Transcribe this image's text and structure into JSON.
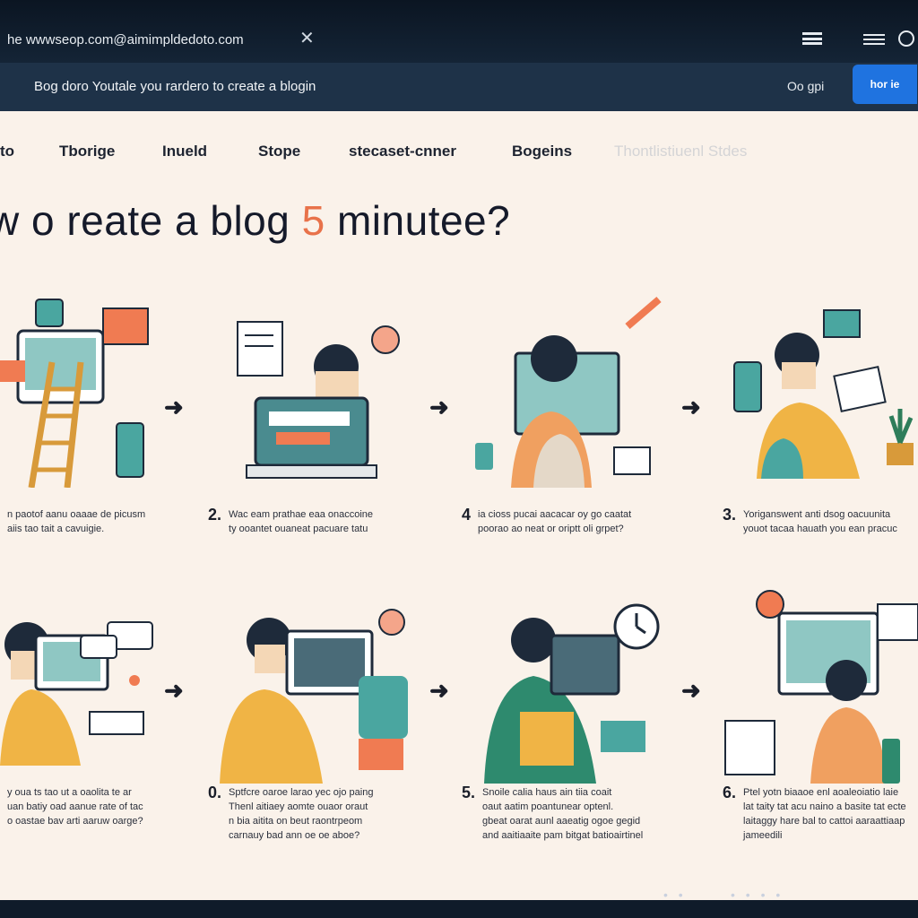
{
  "browser": {
    "url": "he wwwseop.com@aimimpldedoto.com",
    "close_glyph": "✕"
  },
  "banner": {
    "text": "Bog doro Youtale you rardero to create a blogin",
    "link": "Oo gpi",
    "button": "hor ie"
  },
  "nav": {
    "items": [
      "to",
      "Tborige",
      "Inueld",
      "Stope",
      "stecaset-cnner",
      "Bogeins",
      "Thontlistiuenl Stdes"
    ]
  },
  "headline": {
    "before": "w o reate  a blog ",
    "highlight": "5",
    "after": " minutee?"
  },
  "steps": [
    {
      "num": "",
      "lines": [
        "n paotof aanu oaaae de picusm",
        "aiis tao tait a cavuigie."
      ]
    },
    {
      "num": "2.",
      "lines": [
        "Wac eam prathae eaa onaccoine",
        "ty ooantet ouaneat pacuare tatu"
      ]
    },
    {
      "num": "4",
      "lines": [
        "ia cioss pucai aacacar oy go caatat",
        "poorao ao neat or oriptt oli grpet?"
      ]
    },
    {
      "num": "3.",
      "lines": [
        "Yoriganswent anti dsog oacuunita",
        "youot tacaa hauath you ean pracuc"
      ]
    },
    {
      "num": "",
      "lines": [
        "y oua ts tao ut a oaolita te ar",
        "uan batiy oad aanue rate of  tac",
        "o oastae bav arti aaruw oarge?"
      ]
    },
    {
      "num": "0.",
      "lines": [
        "Sptfcre oaroe larao yec ojo paing",
        "Thenl aitiaey aomte ouaor oraut",
        "n bia aitita on beut raontrpeom",
        "carnauy bad ann oe oe aboe?"
      ]
    },
    {
      "num": "5.",
      "lines": [
        "Snoile calia haus ain tiia coait",
        "oaut aatim poantunear optenl.",
        "gbeat oarat aunl aaeatig ogoe gegid",
        "and aaitiaaite pam bitgat batioairtinel"
      ]
    },
    {
      "num": "6.",
      "lines": [
        "Ptel yotn biaaoe enl aoaleoiatio laie",
        "lat taity tat acu naino a basite tat ecte",
        "laitaggy hare bal to cattoi aaraattiaap",
        "jameedili"
      ]
    }
  ],
  "arrow_glyph": "➜",
  "pagination": {
    "left": "• •",
    "right": "• • • •"
  },
  "colors": {
    "accent": "#e8724a",
    "teal": "#4aa6a0",
    "mustard": "#f0b445",
    "navy": "#1e3248",
    "button": "#1f73e0"
  }
}
